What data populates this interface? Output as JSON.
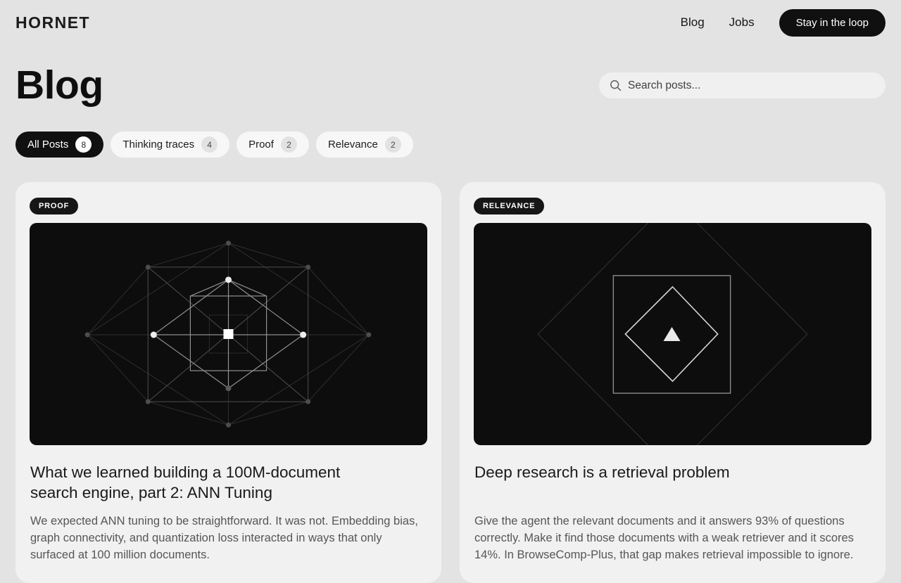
{
  "header": {
    "logo": "HORNET",
    "nav": [
      {
        "label": "Blog"
      },
      {
        "label": "Jobs"
      }
    ],
    "cta_label": "Stay in the loop"
  },
  "page": {
    "title": "Blog",
    "search_placeholder": "Search posts..."
  },
  "filters": [
    {
      "label": "All Posts",
      "count": "8",
      "active": true
    },
    {
      "label": "Thinking traces",
      "count": "4",
      "active": false
    },
    {
      "label": "Proof",
      "count": "2",
      "active": false
    },
    {
      "label": "Relevance",
      "count": "2",
      "active": false
    }
  ],
  "posts": [
    {
      "category": "PROOF",
      "art": "network-graph-cube",
      "title": "What we learned building a 100M-document search engine, part 2: ANN Tuning",
      "excerpt": "We expected ANN tuning to be straightforward. It was not. Embedding bias, graph connectivity, and quantization loss interacted in ways that only surfaced at 100 million documents."
    },
    {
      "category": "RELEVANCE",
      "art": "diamond-triangle",
      "title": "Deep research is a retrieval problem",
      "excerpt": "Give the agent the relevant documents and it answers 93% of questions correctly. Make it find those documents with a weak retriever and it scores 14%. In BrowseComp-Plus, that gap makes retrieval impossible to ignore."
    }
  ],
  "colors": {
    "page_bg": "#e3e3e3",
    "card_bg": "#f1f1f1",
    "art_bg": "#0d0d0d",
    "accent_black": "#101010",
    "excerpt_gray": "#565656"
  }
}
